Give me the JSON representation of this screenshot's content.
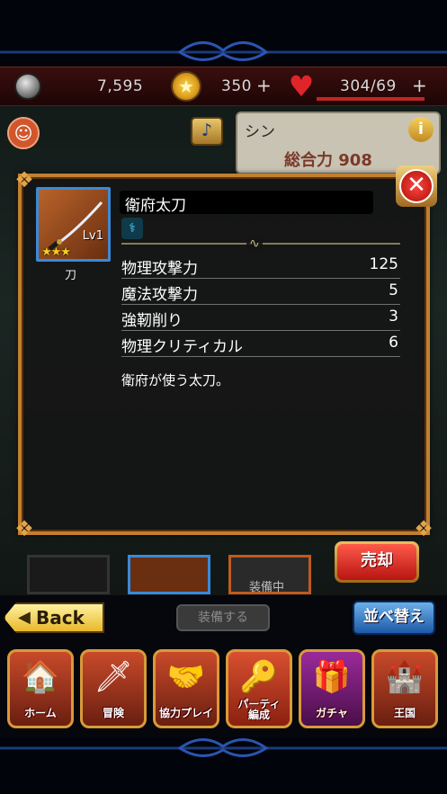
{
  "status": {
    "coins": "7,595",
    "stars": "350",
    "stars_plus": "+",
    "hp": "304/69",
    "hp_plus": "+"
  },
  "character": {
    "name": "シン",
    "power_label": "総合力 908"
  },
  "item": {
    "name": "衛府太刀",
    "level": "Lv1",
    "rarity_stars": "★★★",
    "type": "刀",
    "stats": [
      {
        "label": "物理攻撃力",
        "value": "125"
      },
      {
        "label": "魔法攻撃力",
        "value": "5"
      },
      {
        "label": "強靭削り",
        "value": "3"
      },
      {
        "label": "物理クリティカル",
        "value": "6"
      }
    ],
    "description": "衛府が使う太刀。"
  },
  "buttons": {
    "sell": "売却",
    "back": "Back",
    "equip": "装備する",
    "sort": "並べ替え"
  },
  "equipped_tag": "装備中",
  "nav": [
    {
      "label": "ホーム",
      "icon": "home-icon"
    },
    {
      "label": "冒険",
      "icon": "sword-icon"
    },
    {
      "label": "協力プレイ",
      "icon": "handshake-icon"
    },
    {
      "label": "パーティ\n編成",
      "icon": "key-icon"
    },
    {
      "label": "ガチャ",
      "icon": "chest-icon"
    },
    {
      "label": "王国",
      "icon": "castle-icon"
    }
  ],
  "colors": {
    "dialog_border": "#c08030",
    "sell_red": "#e02a20",
    "sort_blue": "#1e5aa8",
    "hp_red": "#c22424"
  }
}
